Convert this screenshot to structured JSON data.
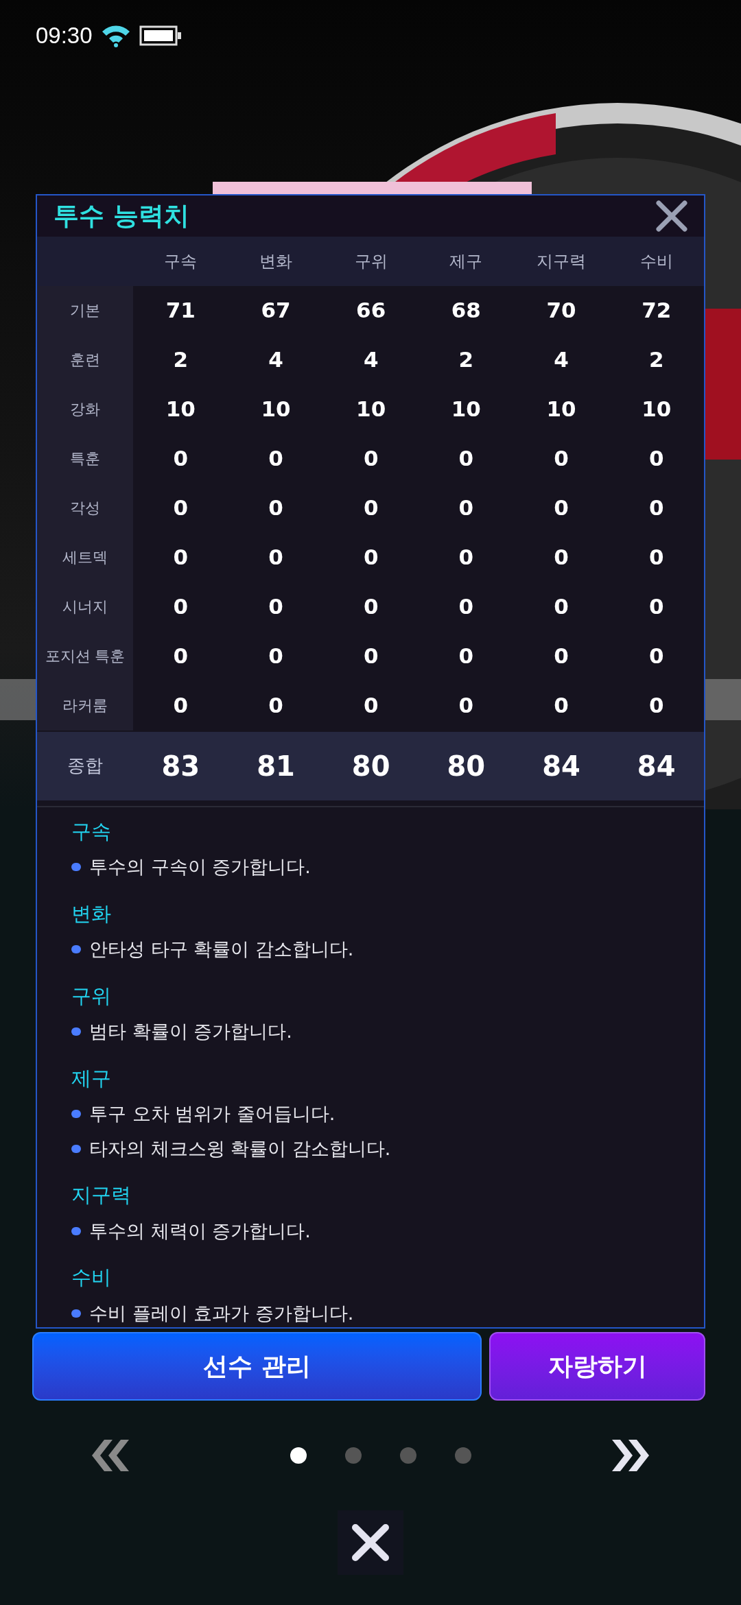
{
  "status_bar": {
    "time": "09:30"
  },
  "dialog": {
    "title": "투수 능력치",
    "columns": [
      "구속",
      "변화",
      "구위",
      "제구",
      "지구력",
      "수비"
    ],
    "rows": [
      {
        "label": "기본",
        "values": [
          "71",
          "67",
          "66",
          "68",
          "70",
          "72"
        ]
      },
      {
        "label": "훈련",
        "values": [
          "2",
          "4",
          "4",
          "2",
          "4",
          "2"
        ]
      },
      {
        "label": "강화",
        "values": [
          "10",
          "10",
          "10",
          "10",
          "10",
          "10"
        ]
      },
      {
        "label": "특훈",
        "values": [
          "0",
          "0",
          "0",
          "0",
          "0",
          "0"
        ]
      },
      {
        "label": "각성",
        "values": [
          "0",
          "0",
          "0",
          "0",
          "0",
          "0"
        ]
      },
      {
        "label": "세트덱",
        "values": [
          "0",
          "0",
          "0",
          "0",
          "0",
          "0"
        ]
      },
      {
        "label": "시너지",
        "values": [
          "0",
          "0",
          "0",
          "0",
          "0",
          "0"
        ]
      },
      {
        "label": "포지션 특훈",
        "values": [
          "0",
          "0",
          "0",
          "0",
          "0",
          "0"
        ]
      },
      {
        "label": "라커룸",
        "values": [
          "0",
          "0",
          "0",
          "0",
          "0",
          "0"
        ]
      }
    ],
    "total": {
      "label": "종합",
      "values": [
        "83",
        "81",
        "80",
        "80",
        "84",
        "84"
      ]
    },
    "descriptions": [
      {
        "title": "구속",
        "items": [
          "투수의 구속이 증가합니다."
        ]
      },
      {
        "title": "변화",
        "items": [
          "안타성 타구 확률이 감소합니다."
        ]
      },
      {
        "title": "구위",
        "items": [
          "범타 확률이 증가합니다."
        ]
      },
      {
        "title": "제구",
        "items": [
          "투구 오차 범위가 줄어듭니다.",
          "타자의 체크스윙 확률이 감소합니다."
        ]
      },
      {
        "title": "지구력",
        "items": [
          "투수의 체력이 증가합니다."
        ]
      },
      {
        "title": "수비",
        "items": [
          "수비 플레이 효과가 증가합니다."
        ]
      }
    ]
  },
  "buttons": [
    {
      "label": "선수 관리",
      "kind": "primary"
    },
    {
      "label": "자랑하기",
      "kind": "secondary"
    }
  ],
  "pager": [
    {
      "selected": true
    },
    {
      "selected": false
    },
    {
      "selected": false
    },
    {
      "selected": false
    }
  ]
}
